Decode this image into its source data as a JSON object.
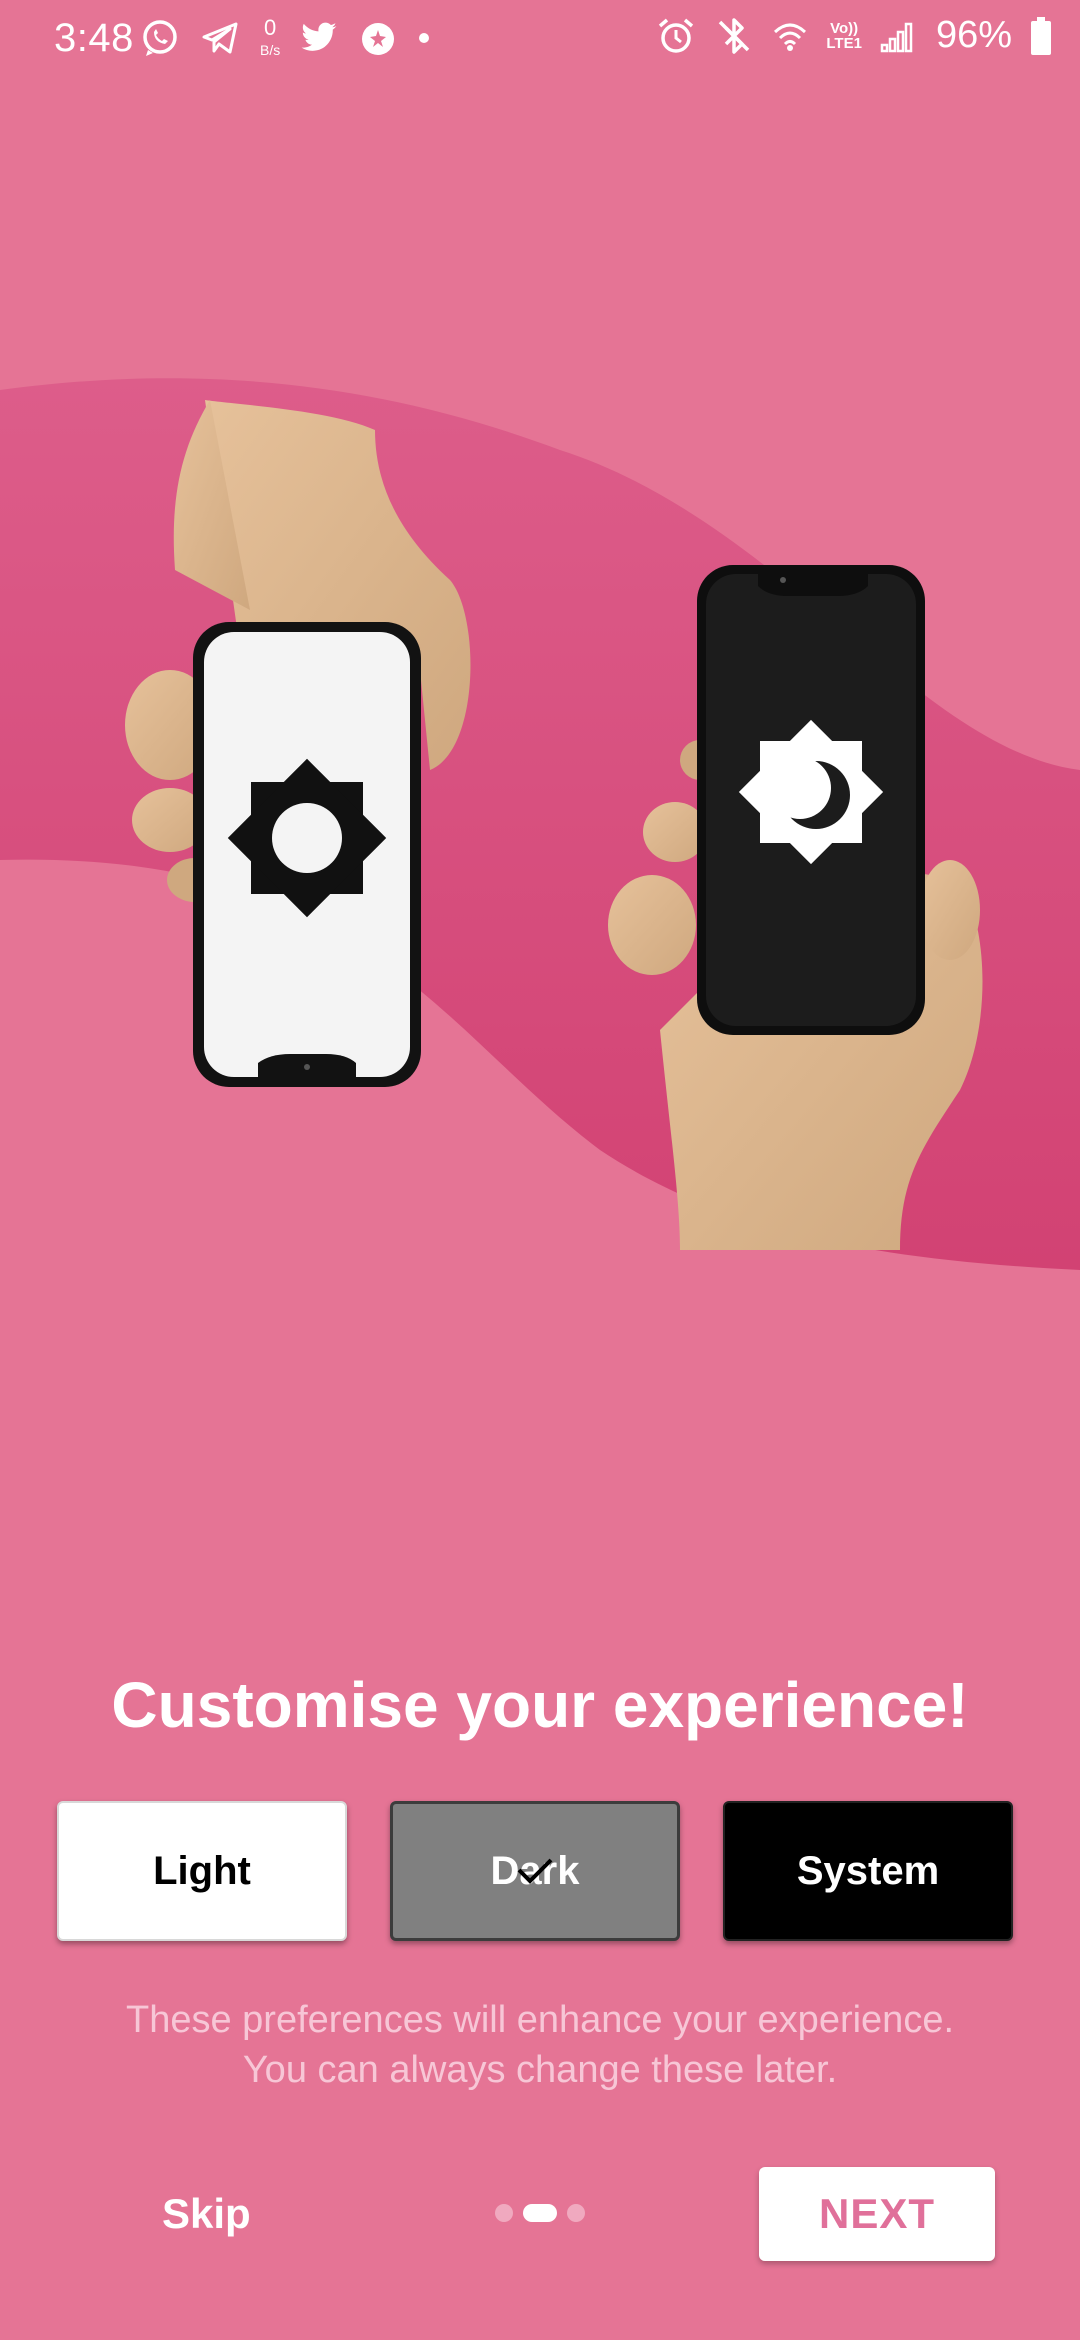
{
  "status_bar": {
    "time": "3:48",
    "net_speed_value": "0",
    "net_speed_unit": "B/s",
    "lte_top": "Vo))",
    "lte_bottom": "LTE1",
    "battery_percent": "96%",
    "left_icons": [
      "whatsapp-icon",
      "telegram-icon",
      "twitter-icon",
      "notification-app-icon",
      "dot-icon"
    ],
    "right_icons": [
      "alarm-icon",
      "bluetooth-off-icon",
      "wifi-icon",
      "signal-icon",
      "battery-icon"
    ]
  },
  "hero": {
    "icons": [
      "light-mode-sun-icon",
      "dark-mode-moon-icon"
    ]
  },
  "onboarding": {
    "title": "Customise your experience!",
    "description_line1": "These preferences will enhance your experience.",
    "description_line2": "You can always change these later."
  },
  "theme_options": {
    "light": "Light",
    "dark": "Dark",
    "system": "System",
    "selected": "Dark"
  },
  "navigation": {
    "skip": "Skip",
    "next": "NEXT",
    "page_count": 3,
    "current_page": 2
  },
  "colors": {
    "background": "#e57495",
    "wave": "#d64f7e",
    "next_text": "#e0709a"
  }
}
